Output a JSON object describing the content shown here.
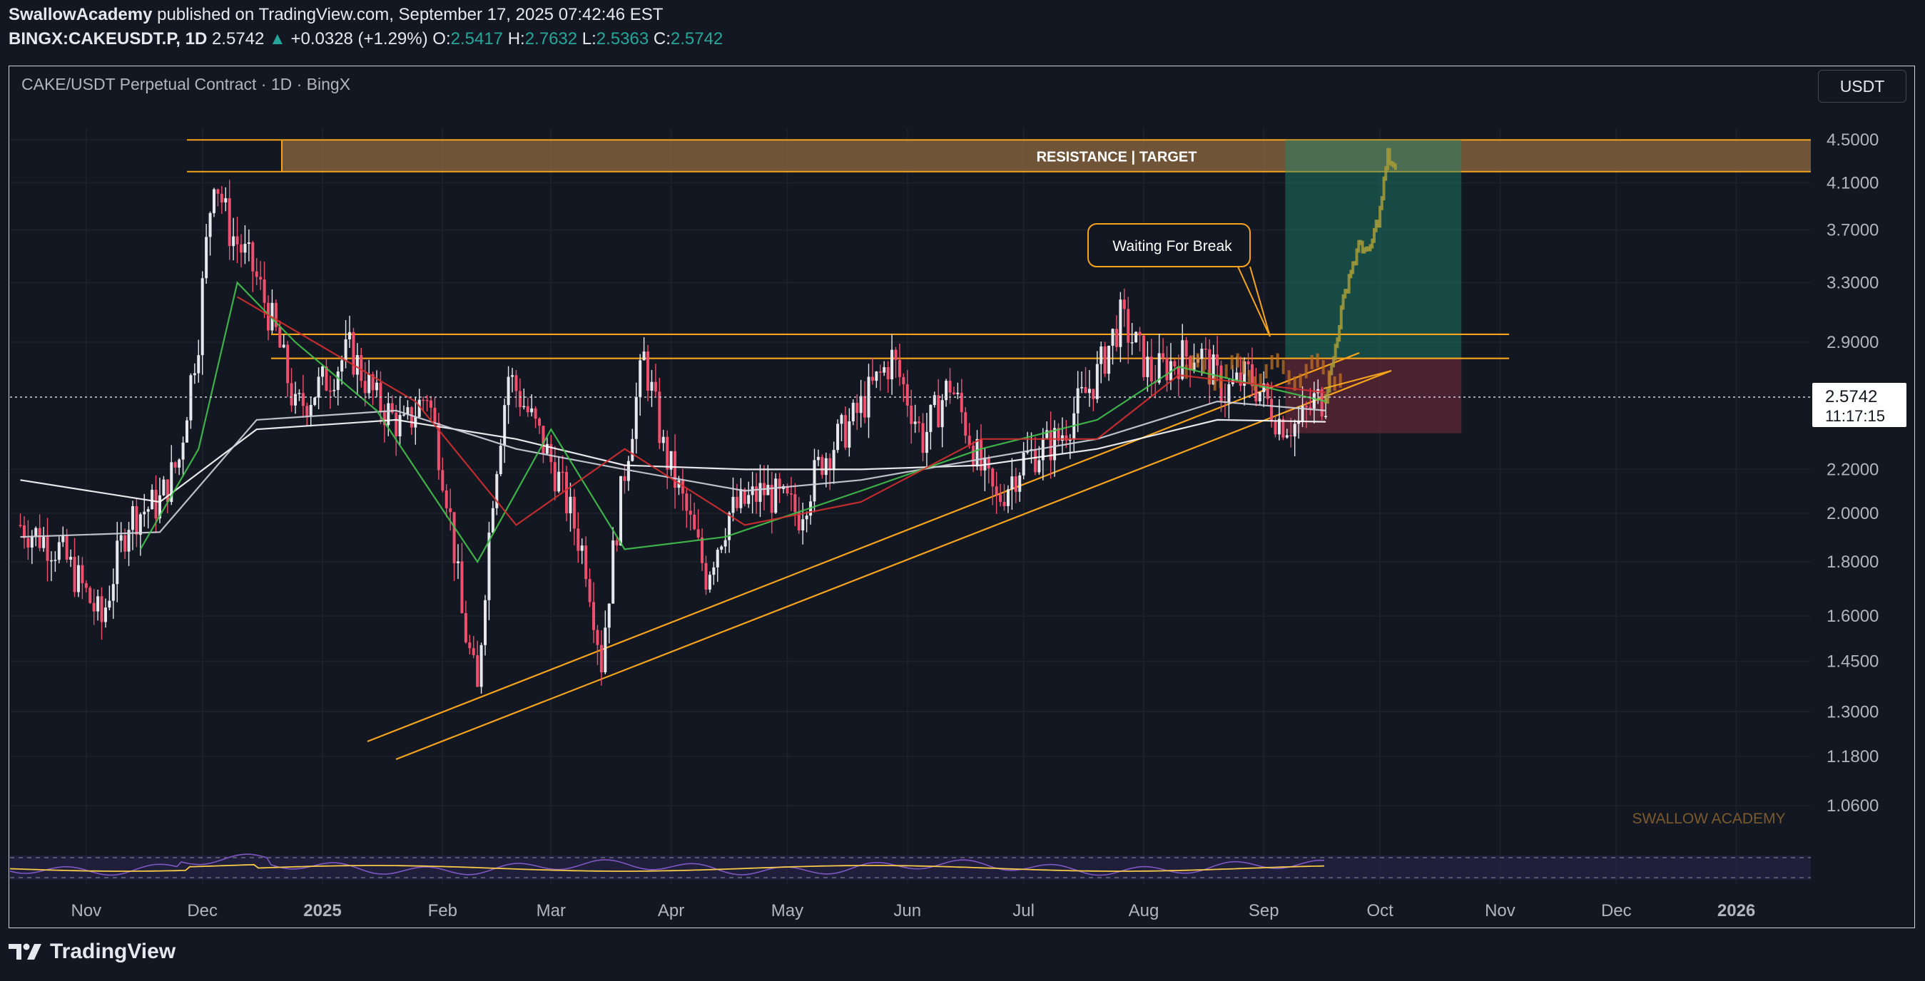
{
  "header": {
    "publisher": "SwallowAcademy",
    "published_text": "published on TradingView.com, September 17, 2025 07:42:46 EST",
    "symbol": "BINGX:CAKEUSDT.P, 1D",
    "last": "2.5742",
    "change_arrow": "▲",
    "change": "+0.0328 (+1.29%)",
    "o_label": "O:",
    "o_value": "2.5417",
    "h_label": "H:",
    "h_value": "2.7632",
    "l_label": "L:",
    "l_value": "2.5363",
    "c_label": "C:",
    "c_value": "2.5742"
  },
  "chart": {
    "instrument_title": "CAKE/USDT Perpetual Contract · 1D · BingX",
    "currency_button": "USDT"
  },
  "footer": {
    "brand": "TradingView",
    "logo_icon": "tradingview-logo-icon"
  },
  "chart_data": {
    "type": "candlestick",
    "title": "CAKE/USDT Perpetual Contract · 1D · BingX",
    "price_scale": "log",
    "y_ticks": [
      "4.5000",
      "4.1000",
      "3.7000",
      "3.3000",
      "2.9000",
      "2.2000",
      "2.0000",
      "1.8000",
      "1.6000",
      "1.4500",
      "1.3000",
      "1.1800",
      "1.0600"
    ],
    "x_ticks": [
      "Nov",
      "Dec",
      "2025",
      "Feb",
      "Mar",
      "Apr",
      "May",
      "Jun",
      "Jul",
      "Aug",
      "Sep",
      "Oct",
      "Nov",
      "Dec",
      "2026"
    ],
    "last_price_label": "2.5742",
    "countdown_label": "11:17:15",
    "watermark": "SWALLOW ACADEMY",
    "annotations": {
      "resistance_label": "RESISTANCE | TARGET",
      "callout_label": "Waiting For Break",
      "resistance_zone": [
        4.2,
        4.5
      ],
      "breakout_lines": [
        2.95,
        2.8
      ],
      "stop_level": 2.38,
      "target_level": 4.5,
      "entry_level": 2.8
    },
    "price_path": [
      [
        "2024-10-15",
        1.95
      ],
      [
        "2024-10-25",
        1.85
      ],
      [
        "2024-11-05",
        1.58
      ],
      [
        "2024-11-12",
        1.98
      ],
      [
        "2024-11-20",
        2.05
      ],
      [
        "2024-11-25",
        2.25
      ],
      [
        "2024-11-30",
        2.95
      ],
      [
        "2024-12-04",
        4.2
      ],
      [
        "2024-12-08",
        3.7
      ],
      [
        "2024-12-14",
        3.4
      ],
      [
        "2024-12-20",
        2.95
      ],
      [
        "2024-12-25",
        2.5
      ],
      [
        "2025-01-03",
        2.7
      ],
      [
        "2025-01-08",
        2.85
      ],
      [
        "2025-01-15",
        2.55
      ],
      [
        "2025-01-22",
        2.4
      ],
      [
        "2025-01-28",
        2.6
      ],
      [
        "2025-02-02",
        2.1
      ],
      [
        "2025-02-06",
        1.6
      ],
      [
        "2025-02-10",
        1.35
      ],
      [
        "2025-02-14",
        2.1
      ],
      [
        "2025-02-18",
        2.7
      ],
      [
        "2025-02-24",
        2.45
      ],
      [
        "2025-03-03",
        2.15
      ],
      [
        "2025-03-10",
        1.8
      ],
      [
        "2025-03-14",
        1.45
      ],
      [
        "2025-03-20",
        2.2
      ],
      [
        "2025-03-25",
        2.8
      ],
      [
        "2025-03-30",
        2.3
      ],
      [
        "2025-04-06",
        1.95
      ],
      [
        "2025-04-10",
        1.75
      ],
      [
        "2025-04-16",
        2.0
      ],
      [
        "2025-04-25",
        2.1
      ],
      [
        "2025-05-04",
        2.0
      ],
      [
        "2025-05-10",
        2.25
      ],
      [
        "2025-05-18",
        2.45
      ],
      [
        "2025-05-28",
        2.8
      ],
      [
        "2025-06-05",
        2.35
      ],
      [
        "2025-06-12",
        2.65
      ],
      [
        "2025-06-20",
        2.2
      ],
      [
        "2025-06-24",
        2.05
      ],
      [
        "2025-07-01",
        2.25
      ],
      [
        "2025-07-10",
        2.35
      ],
      [
        "2025-07-20",
        2.7
      ],
      [
        "2025-07-26",
        3.05
      ],
      [
        "2025-08-03",
        2.7
      ],
      [
        "2025-08-10",
        2.8
      ],
      [
        "2025-08-15",
        2.85
      ],
      [
        "2025-08-22",
        2.6
      ],
      [
        "2025-08-28",
        2.7
      ],
      [
        "2025-09-05",
        2.45
      ],
      [
        "2025-09-10",
        2.42
      ],
      [
        "2025-09-14",
        2.55
      ],
      [
        "2025-09-17",
        2.5742
      ]
    ],
    "projection_path": [
      [
        "2025-09-17",
        2.58
      ],
      [
        "2025-09-19",
        2.8
      ],
      [
        "2025-09-21",
        3.1
      ],
      [
        "2025-09-23",
        3.35
      ],
      [
        "2025-09-26",
        3.6
      ],
      [
        "2025-09-28",
        3.5
      ],
      [
        "2025-10-01",
        3.85
      ],
      [
        "2025-10-03",
        4.35
      ],
      [
        "2025-10-05",
        4.2
      ]
    ],
    "series": [
      {
        "name": "MA 200 (white)",
        "color": "#ffffff",
        "points": [
          [
            "2024-10-15",
            2.15
          ],
          [
            "2024-11-20",
            2.05
          ],
          [
            "2024-12-15",
            2.4
          ],
          [
            "2025-01-20",
            2.45
          ],
          [
            "2025-02-20",
            2.35
          ],
          [
            "2025-03-20",
            2.22
          ],
          [
            "2025-04-20",
            2.2
          ],
          [
            "2025-05-20",
            2.2
          ],
          [
            "2025-06-20",
            2.22
          ],
          [
            "2025-07-20",
            2.3
          ],
          [
            "2025-08-20",
            2.45
          ],
          [
            "2025-09-17",
            2.44
          ]
        ]
      },
      {
        "name": "MA 100 (light)",
        "color": "#cfd3dc",
        "points": [
          [
            "2024-10-15",
            1.9
          ],
          [
            "2024-11-20",
            1.92
          ],
          [
            "2024-12-15",
            2.45
          ],
          [
            "2025-01-20",
            2.5
          ],
          [
            "2025-02-20",
            2.3
          ],
          [
            "2025-03-20",
            2.2
          ],
          [
            "2025-04-20",
            2.1
          ],
          [
            "2025-05-20",
            2.15
          ],
          [
            "2025-06-20",
            2.25
          ],
          [
            "2025-07-20",
            2.35
          ],
          [
            "2025-08-20",
            2.55
          ],
          [
            "2025-09-17",
            2.5
          ]
        ]
      },
      {
        "name": "EMA fast (green)",
        "color": "#43c24d",
        "points": [
          [
            "2024-11-15",
            1.85
          ],
          [
            "2024-11-30",
            2.3
          ],
          [
            "2024-12-10",
            3.3
          ],
          [
            "2024-12-25",
            2.9
          ],
          [
            "2025-01-15",
            2.5
          ],
          [
            "2025-02-10",
            1.8
          ],
          [
            "2025-03-01",
            2.4
          ],
          [
            "2025-03-20",
            1.85
          ],
          [
            "2025-04-15",
            1.9
          ],
          [
            "2025-05-20",
            2.1
          ],
          [
            "2025-06-20",
            2.3
          ],
          [
            "2025-07-20",
            2.45
          ],
          [
            "2025-08-10",
            2.75
          ],
          [
            "2025-09-17",
            2.55
          ]
        ]
      },
      {
        "name": "EMA mid (red)",
        "color": "#d32f2f",
        "points": [
          [
            "2024-12-10",
            3.2
          ],
          [
            "2024-12-30",
            2.9
          ],
          [
            "2025-01-25",
            2.55
          ],
          [
            "2025-02-20",
            1.95
          ],
          [
            "2025-03-20",
            2.3
          ],
          [
            "2025-04-20",
            1.95
          ],
          [
            "2025-05-20",
            2.05
          ],
          [
            "2025-06-20",
            2.35
          ],
          [
            "2025-07-20",
            2.35
          ],
          [
            "2025-08-10",
            2.7
          ],
          [
            "2025-09-17",
            2.6
          ]
        ]
      }
    ],
    "rsi": {
      "name": "RSI",
      "upper": 70,
      "lower": 30
    }
  }
}
